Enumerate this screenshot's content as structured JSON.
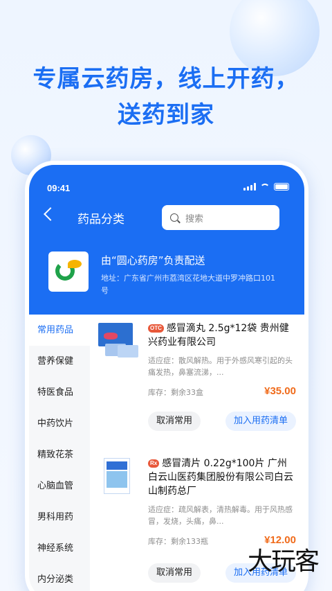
{
  "headline": {
    "line1": "专属云药房，线上开药，",
    "line2": "送药到家"
  },
  "status": {
    "time": "09:41"
  },
  "nav": {
    "title": "药品分类",
    "search_placeholder": "搜索"
  },
  "store": {
    "name": "由“圆心药房”负责配送",
    "address": "地址：广东省广州市荔湾区花地大道中罗冲路口101号"
  },
  "sidebar": {
    "items": [
      {
        "label": "常用药品"
      },
      {
        "label": "营养保健"
      },
      {
        "label": "特医食品"
      },
      {
        "label": "中药饮片"
      },
      {
        "label": "精致花茶"
      },
      {
        "label": "心脑血管"
      },
      {
        "label": "男科用药"
      },
      {
        "label": "神经系统"
      },
      {
        "label": "内分泌类"
      }
    ]
  },
  "products": [
    {
      "tag": "OTC",
      "title": "感冒滴丸 2.5g*12袋 贵州健兴药业有限公司",
      "desc": "适应症：散风解热。用于外感风寒引起的头痛发热，鼻塞流涕，...",
      "stock": "库存：剩余33盒",
      "price": "¥35.00",
      "btn_cancel": "取消常用",
      "btn_add": "加入用药清单",
      "tag_color": "#e8583a"
    },
    {
      "tag": "Rx",
      "title": "感冒清片 0.22g*100片 广州白云山医药集团股份有限公司白云山制药总厂",
      "desc": "适应症：疏风解表，清热解毒。用于风热感冒，发烧，头痛，鼻...",
      "stock": "库存：剩余133瓶",
      "price": "¥12.00",
      "btn_cancel": "取消常用",
      "btn_add": "加入用药清单",
      "tag_color": "#e8583a"
    }
  ],
  "watermark": "大玩客",
  "colors": {
    "brand_blue": "#1b6ef3",
    "price_orange": "#f06b1b"
  }
}
